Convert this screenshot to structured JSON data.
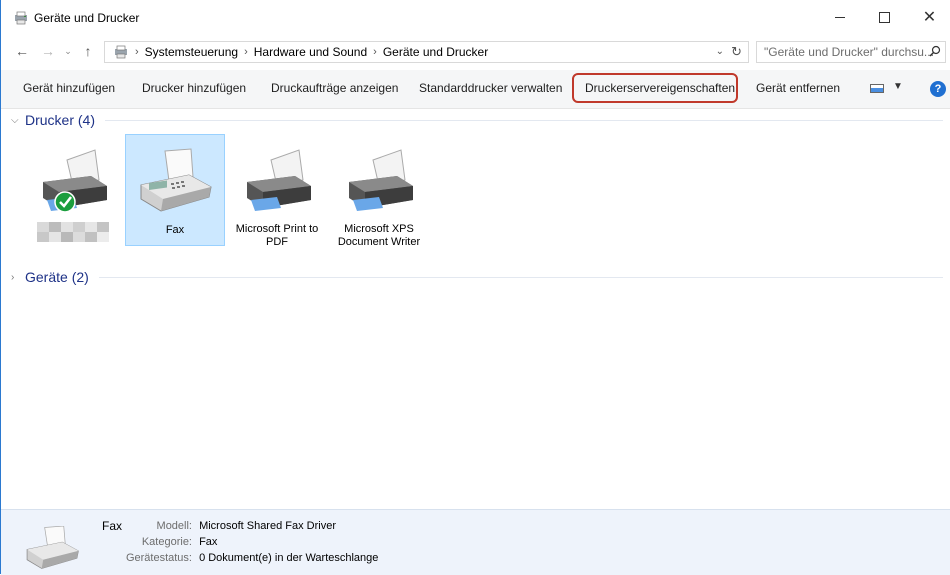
{
  "window": {
    "title": "Geräte und Drucker"
  },
  "nav": {
    "breadcrumbs": [
      "Systemsteuerung",
      "Hardware und Sound",
      "Geräte und Drucker"
    ],
    "search_placeholder": "\"Geräte und Drucker\" durchsu..."
  },
  "commands": {
    "add_device": "Gerät hinzufügen",
    "add_printer": "Drucker hinzufügen",
    "show_jobs": "Druckaufträge anzeigen",
    "manage_default": "Standarddrucker verwalten",
    "server_props": "Druckerservereigenschaften",
    "remove_device": "Gerät entfernen",
    "help": "?"
  },
  "groups": {
    "printers": "Drucker (4)",
    "devices": "Geräte (2)"
  },
  "printers": [
    {
      "label": "",
      "default": true,
      "icon": "printer-icon"
    },
    {
      "label": "Fax",
      "selected": true,
      "icon": "fax-icon"
    },
    {
      "label": "Microsoft Print to PDF",
      "icon": "printer-icon"
    },
    {
      "label": "Microsoft XPS Document Writer",
      "icon": "printer-icon"
    }
  ],
  "details": {
    "name": "Fax",
    "model_key": "Modell:",
    "model_val": "Microsoft Shared Fax Driver",
    "category_key": "Kategorie:",
    "category_val": "Fax",
    "status_key": "Gerätestatus:",
    "status_val": "0 Dokument(e) in der Warteschlange"
  },
  "colors": {
    "highlight_border": "#c0392b",
    "selection": "#cce8ff",
    "group_text": "#1e3287"
  }
}
